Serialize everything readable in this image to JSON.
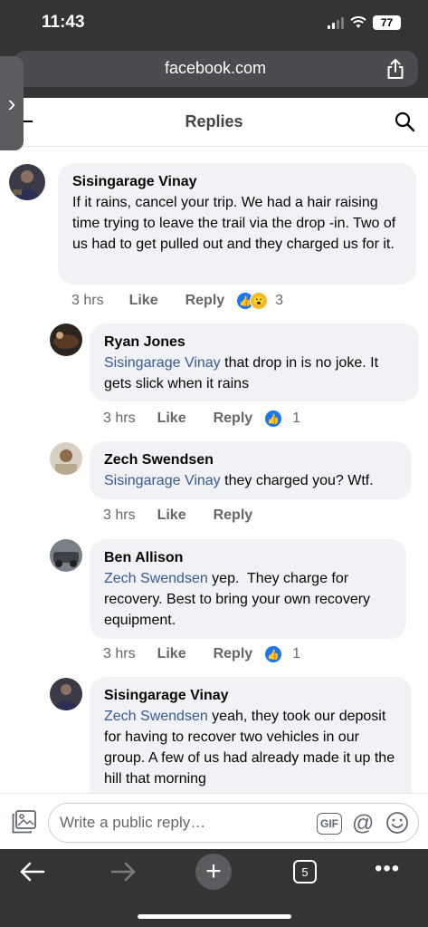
{
  "status": {
    "time": "11:43",
    "battery": "77"
  },
  "browser": {
    "url": "facebook.com",
    "tab_count": "5"
  },
  "header": {
    "title": "Replies"
  },
  "comments": [
    {
      "author": "Sisingarage Vinay",
      "mention": "",
      "text": "If it rains, cancel your trip. We had a hair raising time trying to leave the trail via the drop -in. Two of us had to get pulled out and they charged us for it.",
      "time": "3 hrs",
      "like": "Like",
      "reply": "Reply",
      "reactions": "3"
    },
    {
      "author": "Ryan Jones",
      "mention": "Sisingarage Vinay",
      "text": " that drop in is no joke. It gets slick when it rains",
      "time": "3 hrs",
      "like": "Like",
      "reply": "Reply",
      "reactions": "1"
    },
    {
      "author": "Zech Swendsen",
      "mention": "Sisingarage Vinay",
      "text": " they charged you? Wtf.",
      "time": "3 hrs",
      "like": "Like",
      "reply": "Reply",
      "reactions": ""
    },
    {
      "author": "Ben Allison",
      "mention": "Zech Swendsen",
      "text": " yep.  They charge for recovery. Best to bring your own recovery equipment.",
      "time": "3 hrs",
      "like": "Like",
      "reply": "Reply",
      "reactions": "1"
    },
    {
      "author": "Sisingarage Vinay",
      "mention": "Zech Swendsen",
      "text": " yeah, they took our deposit for having to recover two vehicles in our group. A few of us had already made it up the hill that morning",
      "time": "",
      "like": "",
      "reply": "",
      "reactions": ""
    }
  ],
  "composer": {
    "placeholder": "Write a public reply…",
    "gif": "GIF",
    "at": "@"
  },
  "colors": {
    "chrome": "#333436",
    "bubble": "#f0f2f5",
    "mention": "#385898",
    "like_blue": "#1877f2"
  }
}
